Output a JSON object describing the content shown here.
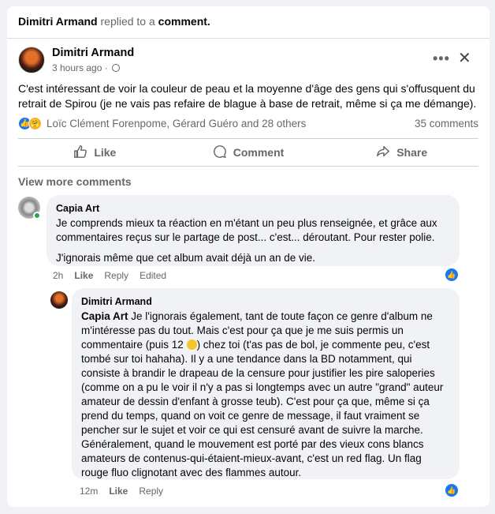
{
  "notification": {
    "actor": "Dimitri Armand",
    "action": "replied to a",
    "target": "comment."
  },
  "post": {
    "author": "Dimitri Armand",
    "time": "3 hours ago",
    "text": "C'est intéressant de voir la couleur de peau et la moyenne d'âge des gens qui s'offusquent du retrait de Spirou (je ne vais pas refaire de blague à base de retrait, même si ça me démange).",
    "reactions_text": "Loïc Clément Forenpome, Gérard Guéro and 28 others",
    "comments_count": "35 comments"
  },
  "actions": {
    "like": "Like",
    "comment": "Comment",
    "share": "Share"
  },
  "view_more": "View more comments",
  "comment1": {
    "author": "Capia Art",
    "p1": "Je comprends mieux ta réaction en m'étant un peu plus renseignée, et grâce aux commentaires reçus sur le partage de post... c'est... déroutant. Pour rester polie.",
    "p2": "J'ignorais même que cet album avait déjà un an de vie.",
    "time": "2h",
    "like": "Like",
    "reply": "Reply",
    "edited": "Edited"
  },
  "reply1": {
    "author": "Dimitri Armand",
    "mention": "Capia Art",
    "text_a": " Je l'ignorais également, tant de toute façon ce genre d'album ne m'intéresse pas du tout. Mais c'est pour ça que je me suis permis un commentaire (puis 12 ",
    "text_b": ") chez toi (t'as pas de bol, je commente peu, c'est tombé sur toi hahaha). Il y a une tendance dans la BD notamment, qui consiste à brandir le drapeau de la censure pour justifier les pire saloperies (comme on a pu le voir il n'y a pas si longtemps avec un autre \"grand\" auteur amateur de dessin d'enfant à grosse teub). C'est pour ça que, même si ça prend du temps, quand on voit ce genre de message, il faut vraiment se pencher sur le sujet et voir ce qui est censuré avant de suivre la marche. Généralement, quand le mouvement est porté par des vieux cons blancs amateurs de contenus-qui-étaient-mieux-avant, c'est un red flag. Un flag rouge fluo clignotant avec des flammes autour.",
    "time": "12m",
    "like": "Like",
    "reply": "Reply"
  }
}
